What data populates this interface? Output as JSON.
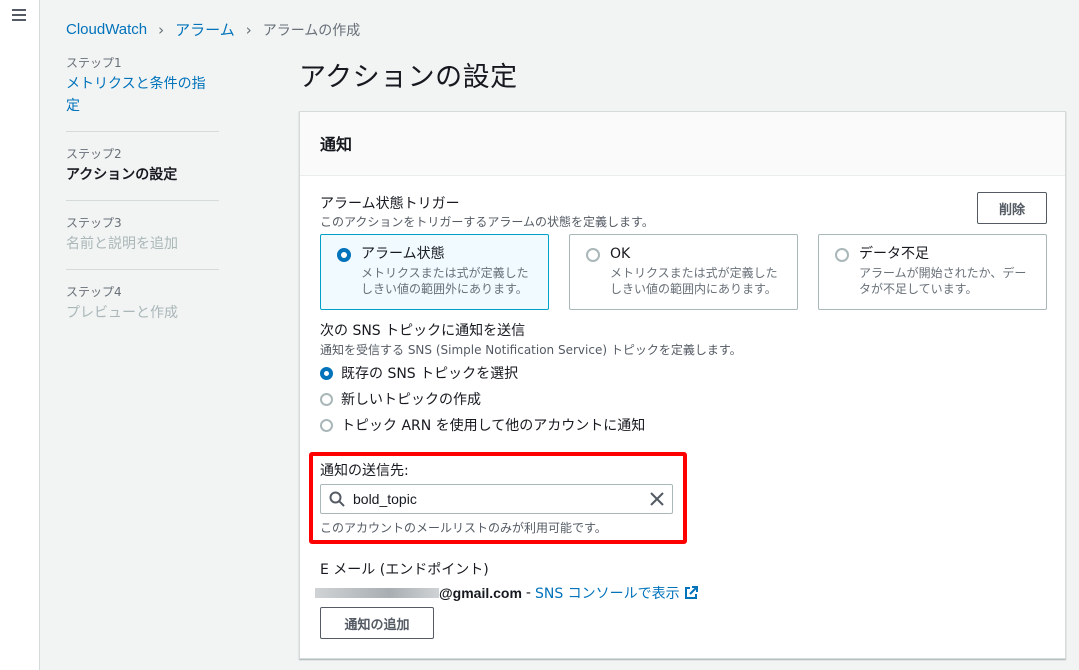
{
  "breadcrumb": {
    "root": "CloudWatch",
    "alarms": "アラーム",
    "current": "アラームの作成"
  },
  "steps": [
    {
      "num": "ステップ1",
      "title": "メトリクスと条件の指定"
    },
    {
      "num": "ステップ2",
      "title": "アクションの設定"
    },
    {
      "num": "ステップ3",
      "title": "名前と説明を追加"
    },
    {
      "num": "ステップ4",
      "title": "プレビューと作成"
    }
  ],
  "page_title": "アクションの設定",
  "panel": {
    "title": "通知",
    "trigger_label": "アラーム状態トリガー",
    "trigger_desc": "このアクションをトリガーするアラームの状態を定義します。",
    "delete_label": "削除",
    "tiles": [
      {
        "title": "アラーム状態",
        "desc1": "メトリクスまたは式が定義した",
        "desc2": "しきい値の範囲外にあります。"
      },
      {
        "title": "OK",
        "desc1": "メトリクスまたは式が定義した",
        "desc2": "しきい値の範囲内にあります。"
      },
      {
        "title": "データ不足",
        "desc1": "アラームが開始されたか、デー",
        "desc2": "タが不足しています。"
      }
    ],
    "sns_label": "次の SNS トピックに通知を送信",
    "sns_desc": "通知を受信する SNS (Simple Notification Service) トピックを定義します。",
    "sns_options": [
      "既存の SNS トピックを選択",
      "新しいトピックの作成",
      "トピック ARN を使用して他のアカウントに通知"
    ],
    "dest_label": "通知の送信先:",
    "search_value": "bold_topic",
    "dest_hint": "このアカウントのメールリストのみが利用可能です。",
    "email_label": "E メール (エンドポイント)",
    "email_domain": "@gmail.com",
    "email_dash": "-",
    "console_link": "SNS コンソールで表示",
    "add_label": "通知の追加"
  },
  "colors": {
    "link": "#0073bb",
    "selected_tile_bg": "#f1faff",
    "highlight": "#ff0000"
  }
}
